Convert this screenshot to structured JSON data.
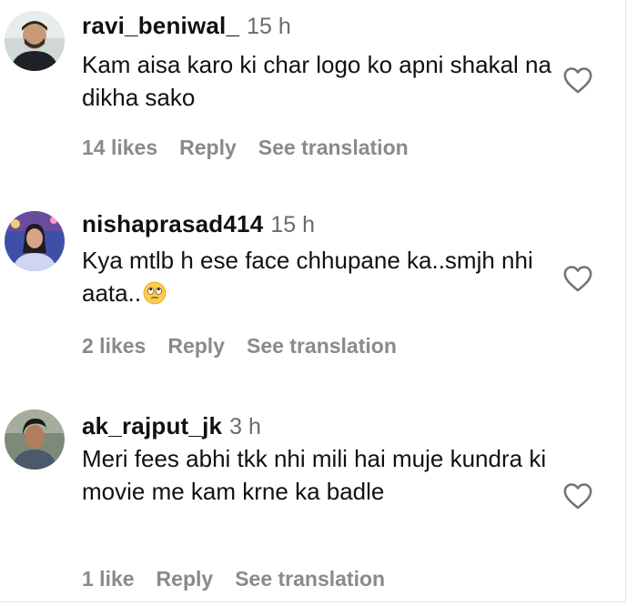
{
  "comments": [
    {
      "username": "ravi_beniwal_",
      "time": "15 h",
      "text": "Kam aisa karo ki char logo ko apni shakal na dikha sako",
      "likes": "14 likes",
      "reply": "Reply",
      "see_translation": "See translation",
      "avatar_icon": "avatar-photo"
    },
    {
      "username": "nishaprasad414",
      "time": "15 h",
      "text": "Kya mtlb h ese face chhupane ka..smjh nhi aata..",
      "emoji": "face-with-rolling-eyes",
      "likes": "2 likes",
      "reply": "Reply",
      "see_translation": "See translation",
      "avatar_icon": "avatar-photo"
    },
    {
      "username": "ak_rajput_jk",
      "time": "3 h",
      "text": "Meri fees abhi tkk nhi mili hai muje kundra ki movie me kam krne ka badle",
      "likes": "1 like",
      "reply": "Reply",
      "see_translation": "See translation",
      "avatar_icon": "avatar-photo"
    }
  ],
  "icons": {
    "like": "heart-outline-icon"
  },
  "colors": {
    "text": "#111111",
    "secondary": "#6b6b6b",
    "meta": "#8a8a8a",
    "background": "#ffffff"
  }
}
